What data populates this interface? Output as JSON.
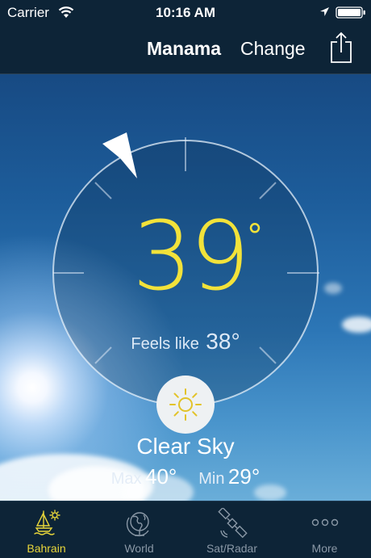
{
  "status_bar": {
    "carrier": "Carrier",
    "time": "10:16 AM",
    "icons": [
      "wifi-icon",
      "location-arrow-icon",
      "battery-icon"
    ]
  },
  "nav": {
    "city": "Manama",
    "change_label": "Change",
    "share_icon": "share-icon"
  },
  "weather": {
    "temperature": "39",
    "degree_symbol": "°",
    "feels_like_label": "Feels like",
    "feels_like_value": "38°",
    "condition": "Clear Sky",
    "condition_icon": "sun-icon",
    "max_label": "Max",
    "max_value": "40°",
    "min_label": "Min",
    "min_value": "29°"
  },
  "tab_bar": {
    "tabs": [
      {
        "label": "Bahrain",
        "icon": "sailboat-sun-icon",
        "active": true
      },
      {
        "label": "World",
        "icon": "globe-icon",
        "active": false
      },
      {
        "label": "Sat/Radar",
        "icon": "satellite-icon",
        "active": false
      },
      {
        "label": "More",
        "icon": "more-dots-icon",
        "active": false
      }
    ]
  },
  "colors": {
    "accent": "#f2e23a",
    "bar_background": "#0d2437",
    "inactive_tab": "#8a98a6"
  }
}
